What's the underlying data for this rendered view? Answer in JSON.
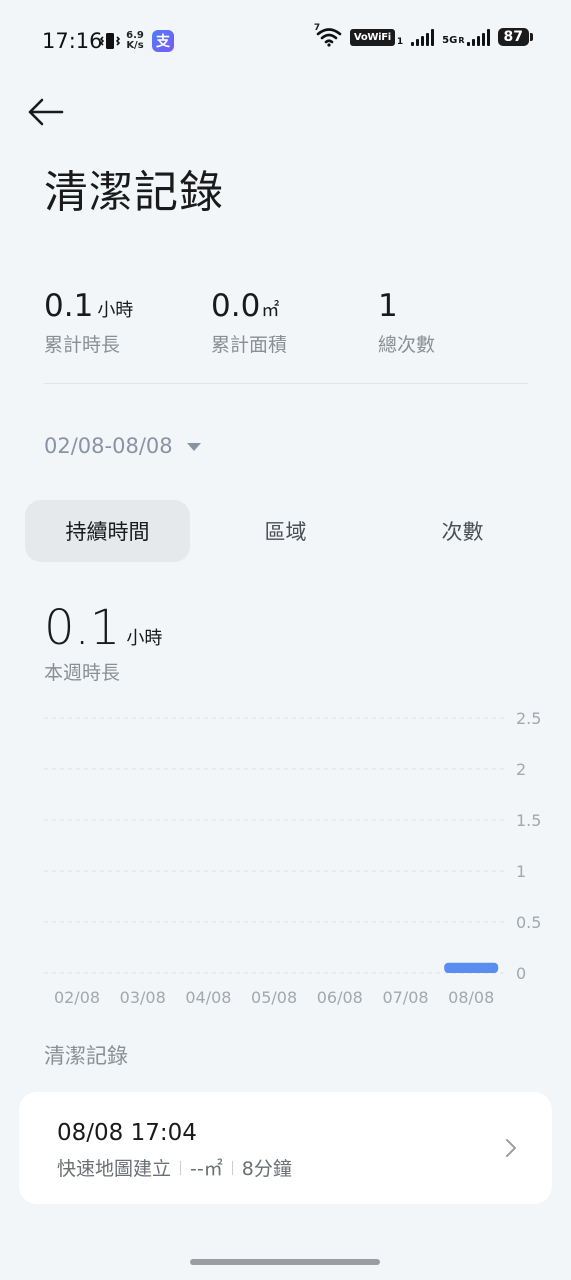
{
  "status_bar": {
    "time": "17:16",
    "net_speed_value": "6.9",
    "net_speed_unit": "K/s",
    "app_icon_char": "支",
    "wifi_sup": "7",
    "vowifi": "VoWiFi",
    "vowifi_sub": "1",
    "five_g": "5G",
    "five_g_sup": "R",
    "battery": "87",
    "icons": [
      "vibrate-icon",
      "wifi-icon",
      "signal-icon",
      "battery-icon"
    ]
  },
  "header": {
    "title": "清潔記錄"
  },
  "stats": [
    {
      "value": "0.1",
      "unit": "小時",
      "label": "累計時長"
    },
    {
      "value": "0.0",
      "unit": "㎡",
      "label": "累計面積"
    },
    {
      "value": "1",
      "unit": "",
      "label": "總次數"
    }
  ],
  "date_range": "02/08-08/08",
  "tabs": [
    {
      "label": "持續時間",
      "active": true
    },
    {
      "label": "區域",
      "active": false
    },
    {
      "label": "次數",
      "active": false
    }
  ],
  "summary": {
    "value": "0.1",
    "unit": "小時",
    "label": "本週時長"
  },
  "chart_data": {
    "type": "bar",
    "categories": [
      "02/08",
      "03/08",
      "04/08",
      "05/08",
      "06/08",
      "07/08",
      "08/08"
    ],
    "values": [
      0,
      0,
      0,
      0,
      0,
      0,
      0.1
    ],
    "y_ticks": [
      "2.5",
      "2",
      "1.5",
      "1",
      "0.5",
      "0"
    ],
    "ylim": [
      0,
      2.5
    ],
    "grid": true,
    "bar_color": "#5b8def",
    "title": "",
    "xlabel": "",
    "ylabel": ""
  },
  "records_section": {
    "label": "清潔記錄",
    "items": [
      {
        "time": "08/08 17:04",
        "mode": "快速地圖建立",
        "area": "--㎡",
        "duration": "8分鐘"
      }
    ]
  },
  "colors": {
    "background": "#f2f6f8",
    "accent": "#5b8def",
    "muted_text": "#8a8f94"
  }
}
